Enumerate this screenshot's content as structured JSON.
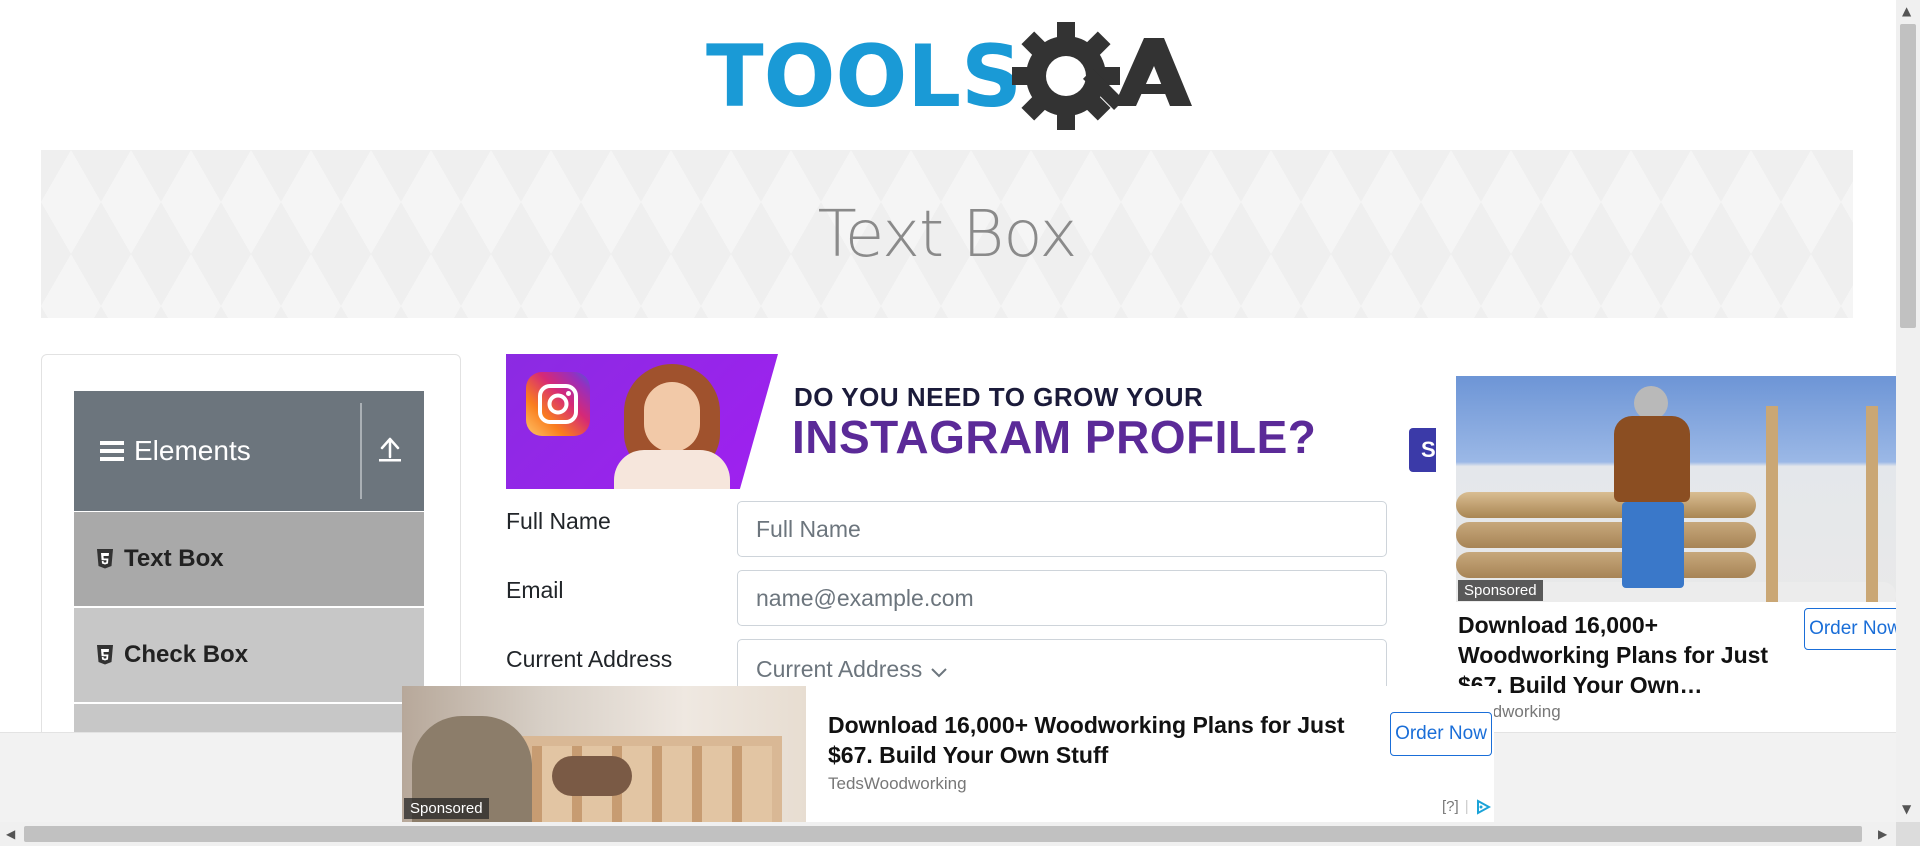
{
  "header": {
    "logo_alt": "TOOLSQA"
  },
  "banner": {
    "title": "Text Box"
  },
  "sidebar": {
    "group_title": "Elements",
    "items": [
      {
        "label": "Text Box"
      },
      {
        "label": "Check Box"
      }
    ]
  },
  "instagram_ad": {
    "line1": "DO YOU NEED TO GROW YOUR",
    "line2": "INSTAGRAM PROFILE?"
  },
  "side_tab": {
    "label": "S"
  },
  "form": {
    "full_name": {
      "label": "Full Name",
      "placeholder": "Full Name"
    },
    "email": {
      "label": "Email",
      "placeholder": "name@example.com"
    },
    "current_address": {
      "label": "Current Address",
      "placeholder": "Current Address"
    }
  },
  "right_ad": {
    "sponsored": "Sponsored",
    "title": "Download 16,000+ Woodworking Plans for Just $67. Build Your Own…",
    "source": "Woodworking",
    "order": "Order Now"
  },
  "bottom_ad": {
    "sponsored": "Sponsored",
    "title": "Download 16,000+ Woodworking Plans for Just $67. Build Your Own Stuff",
    "source": "TedsWoodworking",
    "order": "Order Now",
    "adchoices": "[?]"
  },
  "colors": {
    "logo_blue": "#1a9ad6",
    "logo_dark": "#333333",
    "sidebar_header": "#6c757d",
    "sidebar_active": "#a9a9a9",
    "sidebar_item": "#c7c7c7",
    "instagram_purple": "#5b2a98",
    "ad_button": "#1a6ed8"
  },
  "icons": {
    "elements": "hamburger-icon",
    "upload": "upload-icon",
    "item": "html5-icon",
    "adchoices": "adchoices-icon"
  }
}
